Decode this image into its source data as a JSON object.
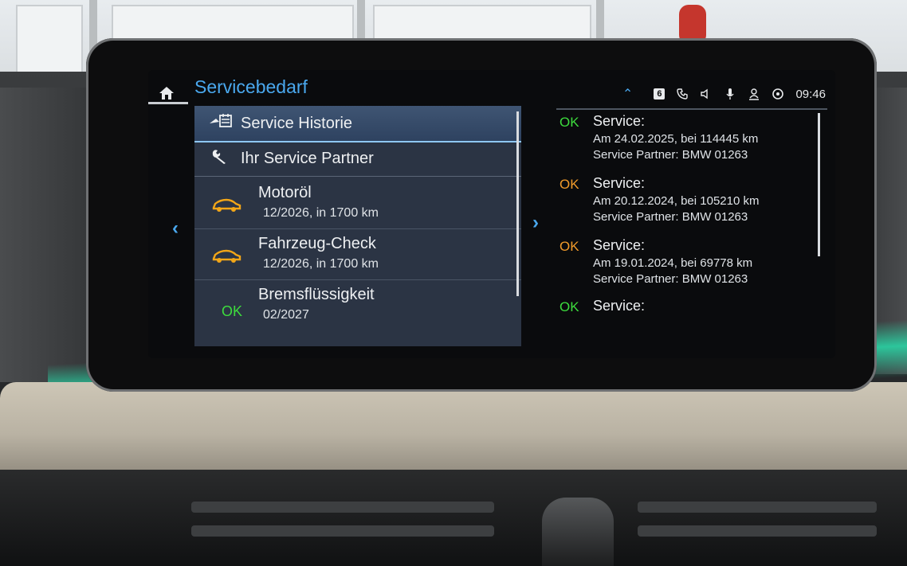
{
  "header": {
    "title": "Servicebedarf",
    "time": "09:46",
    "badge": "6"
  },
  "icons": {
    "home": "home-icon",
    "collapse": "chevron-up-icon",
    "phone": "phone-icon",
    "volume": "speaker-icon",
    "mic": "microphone-icon",
    "user": "user-icon",
    "connect": "connected-drive-icon"
  },
  "menu": {
    "items": [
      {
        "label": "Service Historie",
        "icon": "service-history-icon",
        "selected": true
      },
      {
        "label": "Ihr Service Partner",
        "icon": "wrench-icon",
        "selected": false
      }
    ],
    "entries": [
      {
        "name": "Motoröl",
        "value": "12/2026, in 1700 km",
        "status": "car-icon"
      },
      {
        "name": "Fahrzeug-Check",
        "value": "12/2026, in 1700 km",
        "status": "car-icon"
      },
      {
        "name": "Bremsflüssigkeit",
        "value": "02/2027",
        "status": "OK"
      }
    ]
  },
  "history": [
    {
      "status": "OK",
      "status_color": "#3ddc3d",
      "label": "Service:",
      "line1": "Am 24.02.2025, bei 114445 km",
      "line2": "Service Partner: BMW 01263"
    },
    {
      "status": "OK",
      "status_color": "#f09a2a",
      "label": "Service:",
      "line1": "Am 20.12.2024, bei 105210 km",
      "line2": "Service Partner: BMW 01263"
    },
    {
      "status": "OK",
      "status_color": "#f09a2a",
      "label": "Service:",
      "line1": "Am 19.01.2024, bei 69778 km",
      "line2": "Service Partner: BMW 01263"
    },
    {
      "status": "OK",
      "status_color": "#3ddc3d",
      "label": "Service:",
      "line1": "",
      "line2": ""
    }
  ],
  "colors": {
    "accent": "#4aa8ee",
    "ok_green": "#3ddc3d",
    "warn_orange": "#f09a2a",
    "car_icon": "#f2a618"
  },
  "nav": {
    "prev": "‹",
    "next": "›"
  }
}
